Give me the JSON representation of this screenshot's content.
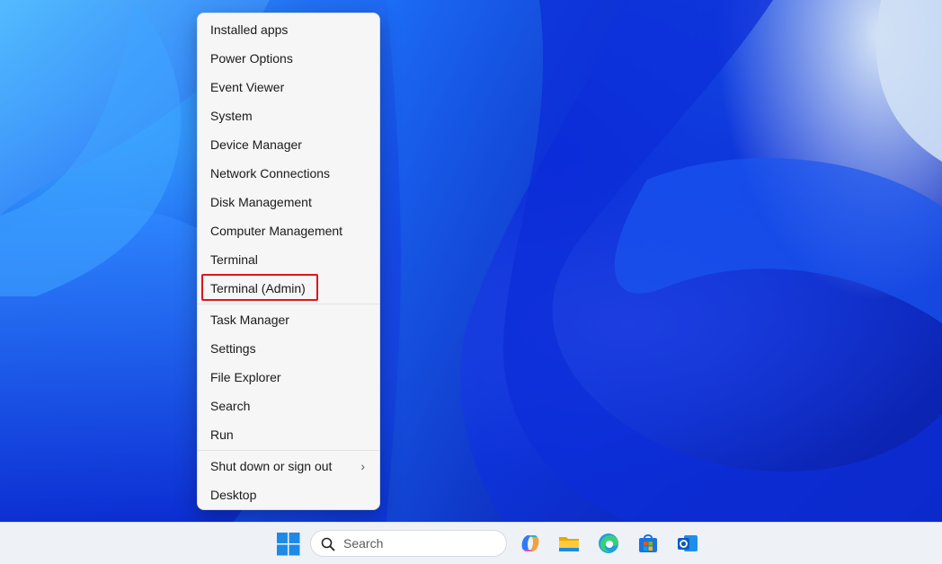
{
  "context_menu": {
    "groups": [
      [
        "Installed apps",
        "Power Options",
        "Event Viewer",
        "System",
        "Device Manager",
        "Network Connections",
        "Disk Management",
        "Computer Management",
        "Terminal",
        "Terminal (Admin)"
      ],
      [
        "Task Manager",
        "Settings",
        "File Explorer",
        "Search",
        "Run"
      ],
      [
        "Shut down or sign out",
        "Desktop"
      ]
    ],
    "highlighted_item": "Terminal (Admin)",
    "submenu_chevron": "›"
  },
  "taskbar": {
    "search_placeholder": "Search",
    "icons": [
      "windows-start-icon",
      "search-icon",
      "copilot-icon",
      "file-explorer-icon",
      "edge-icon",
      "microsoft-store-icon",
      "outlook-icon"
    ]
  },
  "colors": {
    "accent_highlight": "#e0141b",
    "menu_bg": "#f6f6f6",
    "taskbar_bg": "#eef1f6",
    "wallpaper_blue": "#1b5ef0"
  }
}
